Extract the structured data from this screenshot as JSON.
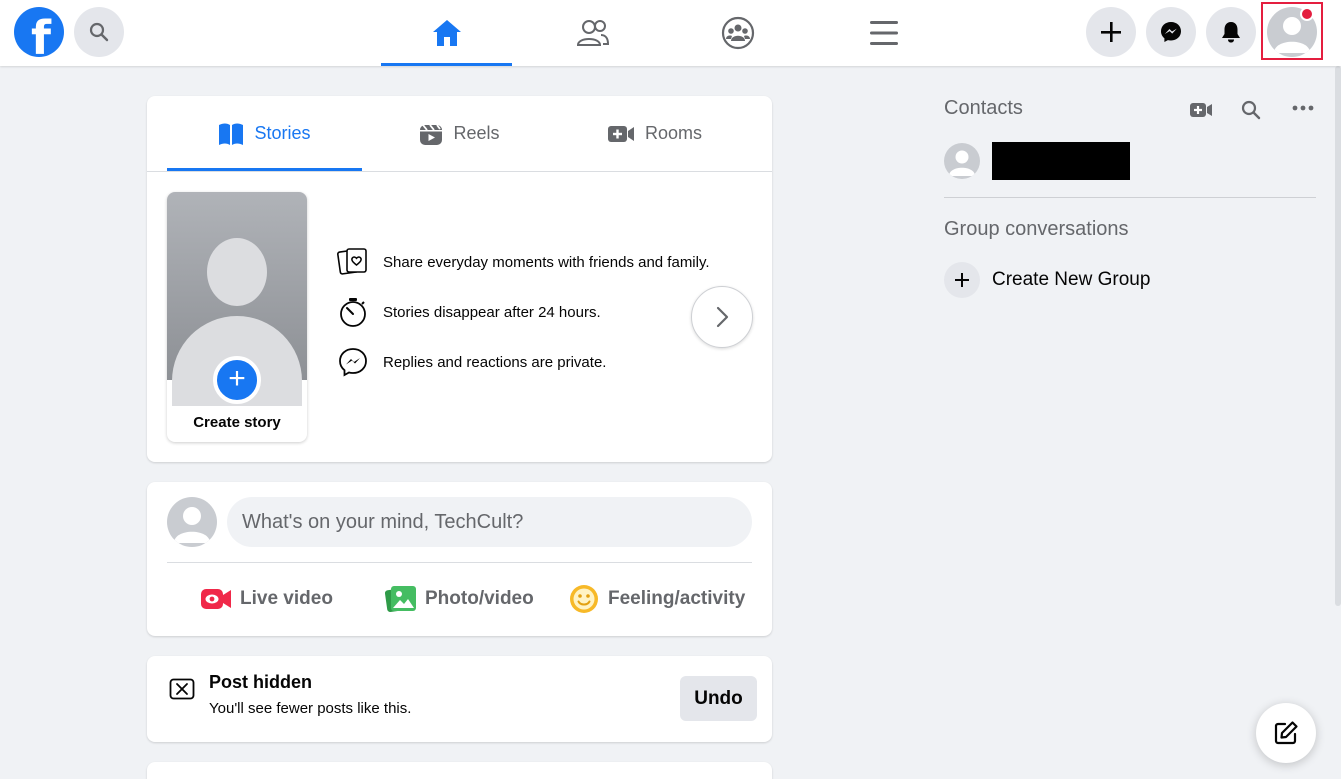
{
  "topbar": {
    "logo_letter": "f",
    "icons": {
      "search": "search-icon",
      "home": "home-icon",
      "friends": "friends-icon",
      "groups": "groups-icon",
      "menu": "hamburger-menu-icon",
      "create": "plus-icon",
      "messenger": "messenger-icon",
      "notifications": "bell-icon"
    },
    "active_tab": "home",
    "has_notification_badge": true
  },
  "stories_card": {
    "tabs": [
      {
        "label": "Stories",
        "icon": "book-icon",
        "active": true
      },
      {
        "label": "Reels",
        "icon": "reels-icon",
        "active": false
      },
      {
        "label": "Rooms",
        "icon": "video-plus-icon",
        "active": false
      }
    ],
    "create_story_label": "Create story",
    "info": [
      {
        "text": "Share everyday moments with friends and family.",
        "icon": "photo-heart-icon"
      },
      {
        "text": "Stories disappear after 24 hours.",
        "icon": "stopwatch-icon"
      },
      {
        "text": "Replies and reactions are private.",
        "icon": "messenger-icon"
      }
    ]
  },
  "composer": {
    "placeholder": "What's on your mind, TechCult?",
    "actions": [
      {
        "label": "Live video",
        "icon": "live-video-icon",
        "color": "#f02849"
      },
      {
        "label": "Photo/video",
        "icon": "photo-icon",
        "color": "#45bd62"
      },
      {
        "label": "Feeling/activity",
        "icon": "smiley-icon",
        "color": "#f7b928"
      }
    ]
  },
  "hidden_post": {
    "title": "Post hidden",
    "subtitle": "You'll see fewer posts like this.",
    "undo_label": "Undo"
  },
  "right_column": {
    "contacts_title": "Contacts",
    "group_conversations_title": "Group conversations",
    "create_group_label": "Create New Group"
  },
  "colors": {
    "brand": "#1877f2",
    "background": "#f0f2f5",
    "alert": "#e41e3f"
  }
}
